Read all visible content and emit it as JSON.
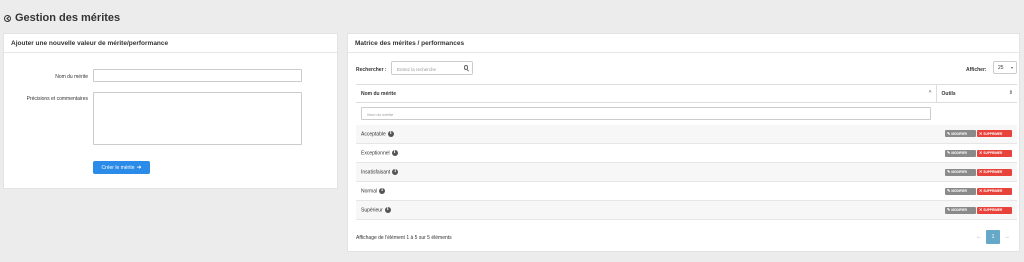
{
  "header": {
    "title": "Gestion des mérites"
  },
  "left_panel": {
    "title": "Ajouter une nouvelle valeur de mérite/performance",
    "name_label": "Nom du mérite",
    "name_value": "",
    "comments_label": "Précisions et commentaires",
    "comments_value": "",
    "create_button": "Créer le mérite"
  },
  "right_panel": {
    "title": "Matrice des mérites / performances",
    "search_label": "Rechercher :",
    "search_placeholder": "Entrez la recherche",
    "show_label": "Afficher:",
    "show_value": "25",
    "columns": [
      "Nom du mérite",
      "Outils"
    ],
    "filter_placeholder": "Nom du mérite",
    "rows": [
      {
        "name": "Acceptable"
      },
      {
        "name": "Exceptionnel"
      },
      {
        "name": "Insatisfaisant"
      },
      {
        "name": "Normal"
      },
      {
        "name": "Supérieur"
      }
    ],
    "modify_label": "MODIFIER",
    "delete_label": "SUPPRIMER",
    "footer_info": "Affichage de l'élément 1 à 5 sur 5 éléments",
    "pager": {
      "prev": "←",
      "current": "1",
      "next": "→"
    }
  }
}
